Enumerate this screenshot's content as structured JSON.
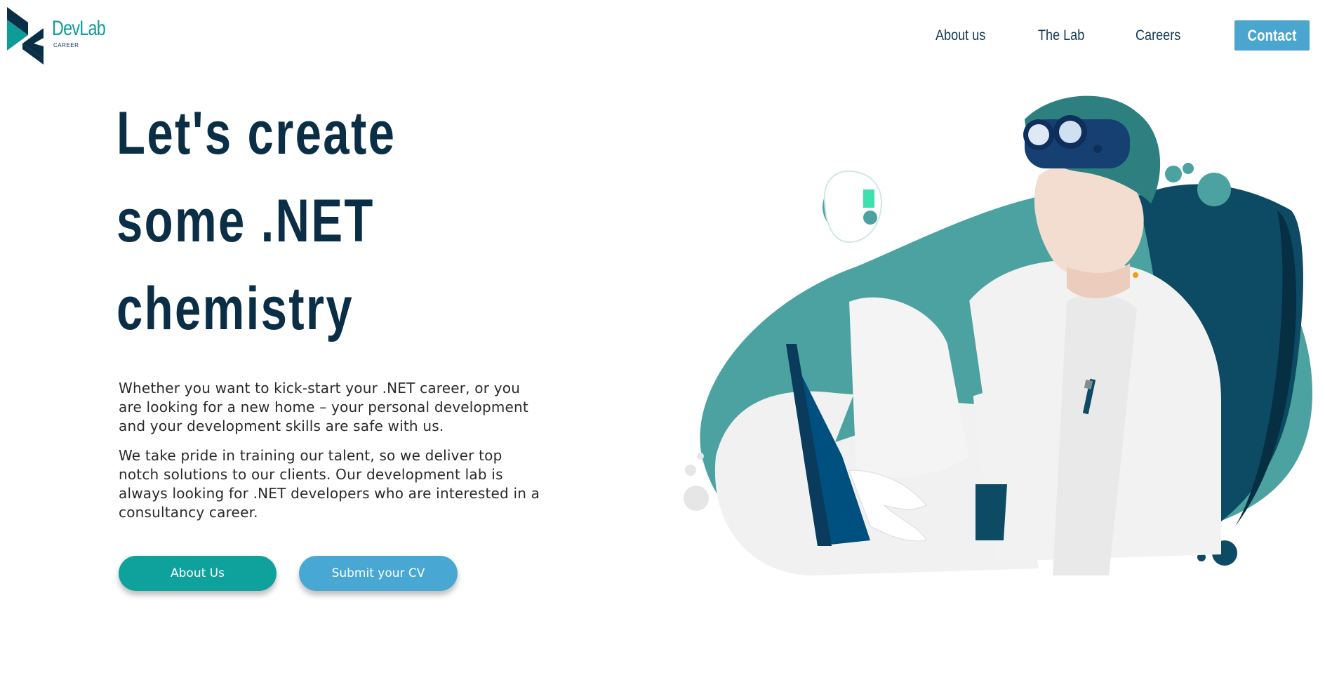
{
  "brand": {
    "name_main": "Dev",
    "name_secondary": "Lab",
    "subtitle": "CAREER",
    "colors": {
      "primary": "#0e9c98",
      "dark": "#0b2e47",
      "accent": "#4aa5cf"
    }
  },
  "nav": {
    "items": [
      {
        "label": "About us"
      },
      {
        "label": "The Lab"
      },
      {
        "label": "Careers"
      }
    ],
    "contact_label": "Contact"
  },
  "hero": {
    "title_lines": [
      "Let's create",
      "some .NET",
      "chemistry"
    ],
    "paragraphs": [
      "Whether you want to kick-start your .NET career, or you are looking for a new home – your personal development and your development skills are safe with us.",
      "We take pride in training our talent, so we deliver top notch solutions to our clients. Our development lab is always looking for .NET developers who are interested in a consultancy career."
    ],
    "buttons": {
      "about": "About Us",
      "cv": "Submit your CV"
    }
  },
  "illustration": {
    "icon": "scientist-with-binoculars-illustration"
  }
}
